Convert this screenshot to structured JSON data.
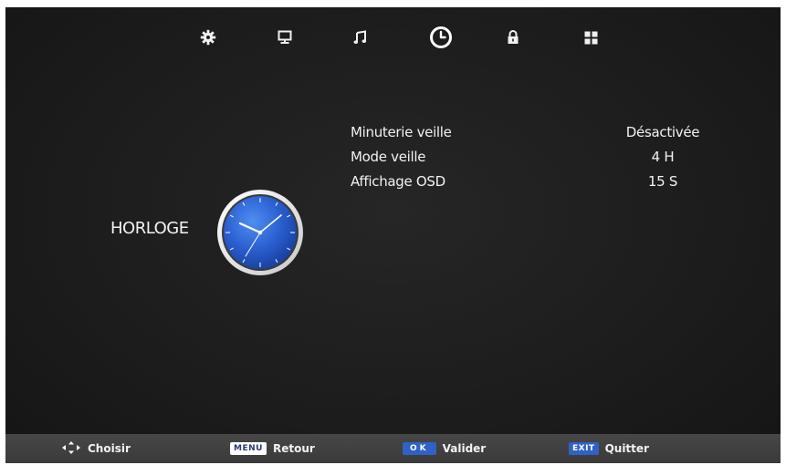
{
  "top_menu": {
    "items": [
      {
        "name": "picture-settings",
        "icon": "gear-icon"
      },
      {
        "name": "screen",
        "icon": "monitor-icon"
      },
      {
        "name": "sound",
        "icon": "music-note-icon"
      },
      {
        "name": "time",
        "icon": "clock-icon",
        "selected": true
      },
      {
        "name": "lock",
        "icon": "lock-icon"
      },
      {
        "name": "options",
        "icon": "grid-icon"
      }
    ]
  },
  "section": {
    "title": "HORLOGE"
  },
  "settings": [
    {
      "label": "Minuterie veille",
      "value": "Désactivée"
    },
    {
      "label": "Mode veille",
      "value": "4 H"
    },
    {
      "label": "Affichage OSD",
      "value": "15 S"
    }
  ],
  "bottom_bar": {
    "choose_label": "Choisir",
    "menu_key": "MENU",
    "back_label": "Retour",
    "ok_key": "OK",
    "validate_label": "Valider",
    "exit_key": "EXIT",
    "quit_label": "Quitter"
  },
  "colors": {
    "background": "#1e1e1e",
    "text": "#f2f2f2",
    "bottom_bar": "#404040",
    "key_blue": "#2f62c4",
    "clock_face": "#2a5fd0"
  }
}
